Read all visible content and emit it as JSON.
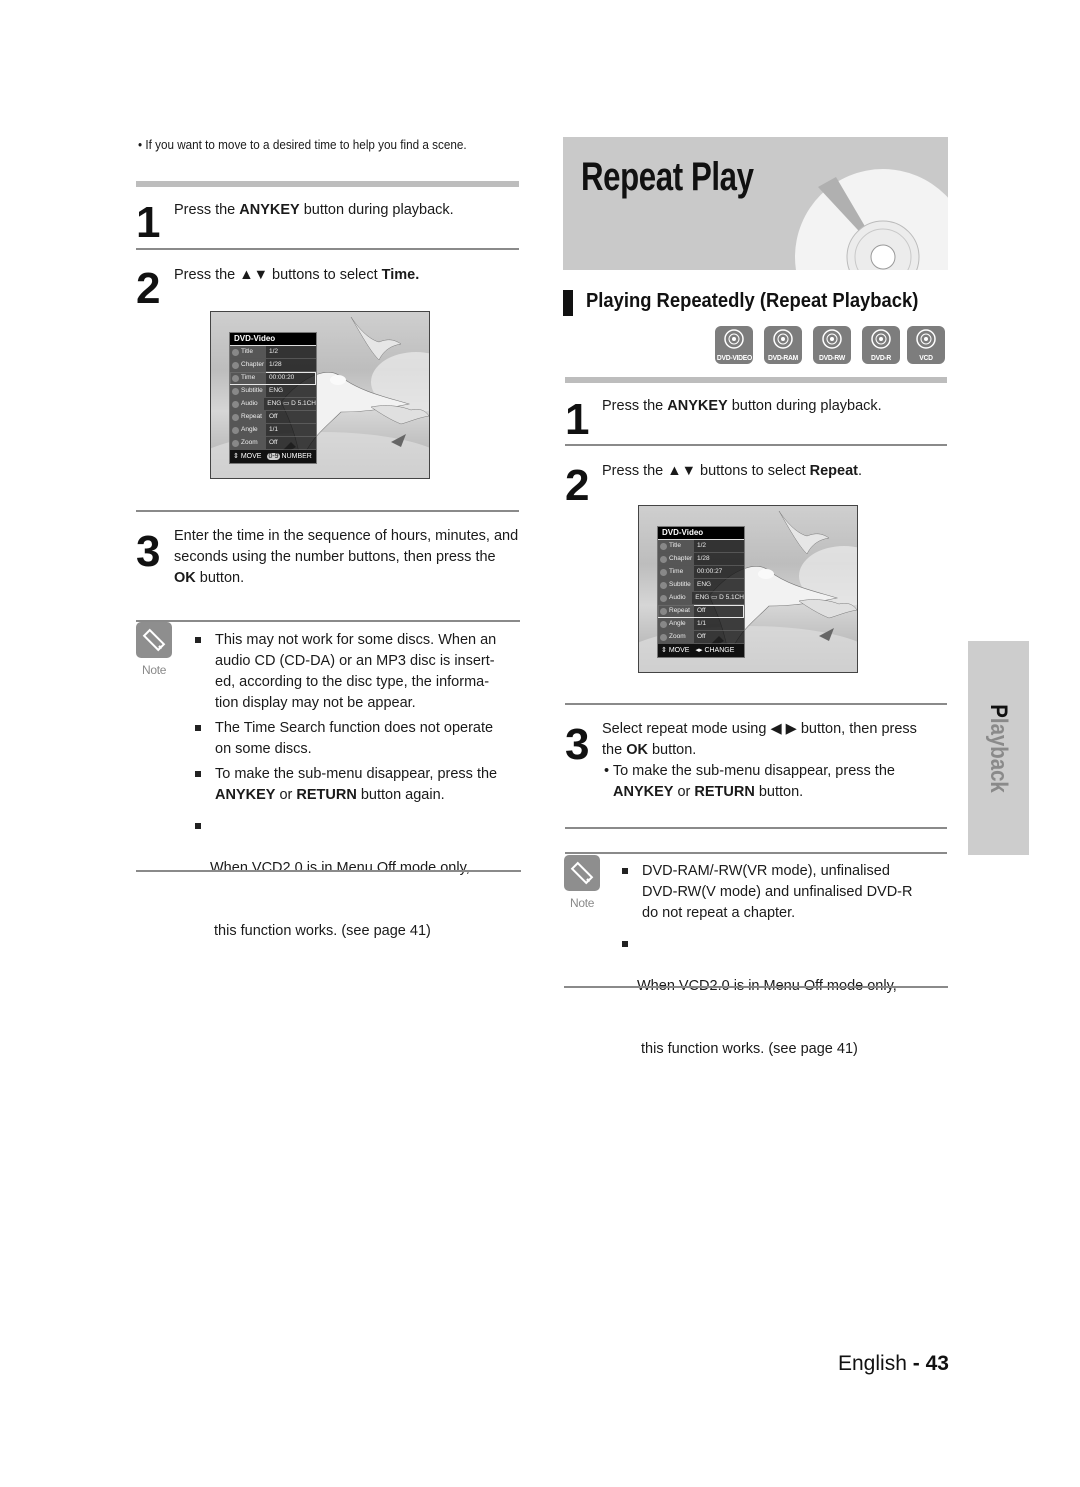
{
  "left": {
    "intro_bullet": "• If you want to move to a desired time to help you find a scene.",
    "steps": [
      {
        "num": "1",
        "pre": "Press the ",
        "bold": "ANYKEY",
        "post": " button during playback."
      },
      {
        "num": "2",
        "pre": "Press the ▲▼ buttons to select ",
        "bold": "Time.",
        "post": ""
      },
      {
        "num": "3",
        "line1": "Enter the time in the sequence of hours, minutes, and",
        "line2": "seconds using the number buttons, then press the",
        "line3_bold": "OK",
        "line3_rest": " button."
      }
    ],
    "osd": {
      "header": "DVD-Video",
      "rows": [
        {
          "label": "Title",
          "value": "1/2",
          "icon": "title-icon"
        },
        {
          "label": "Chapter",
          "value": "1/28",
          "icon": "chapter-icon"
        },
        {
          "label": "Time",
          "value": "00:00:20",
          "icon": "clock-icon",
          "selected": true
        },
        {
          "label": "Subtitle",
          "value": "ENG",
          "icon": "subtitle-icon"
        },
        {
          "label": "Audio",
          "value": "ENG ▭ D  5.1CH",
          "icon": "speaker-icon"
        },
        {
          "label": "Repeat",
          "value": "Off",
          "icon": "repeat-icon"
        },
        {
          "label": "Angle",
          "value": "1/1",
          "icon": "camera-icon"
        },
        {
          "label": "Zoom",
          "value": "Off",
          "icon": "zoom-icon"
        }
      ],
      "footer_move": "MOVE",
      "footer_action_glyph": "0-9",
      "footer_action": "NUMBER"
    },
    "note": {
      "label": "Note",
      "items": [
        {
          "lines": [
            "This may not work for some discs. When an",
            "audio CD (CD-DA) or an MP3 disc is insert-",
            "ed, according to the disc type, the informa-",
            "tion display may not be appear."
          ]
        },
        {
          "lines": [
            "The Time Search function does not operate",
            "on some discs."
          ]
        },
        {
          "line1": "To make the sub-menu disappear, press the",
          "b1": "ANYKEY",
          "mid": " or ",
          "b2": "RETURN",
          "end": " button again."
        },
        {
          "lines": [
            "When VCD2.0 is in Menu Off mode only,",
            " this function works. (see page 41)"
          ]
        }
      ]
    }
  },
  "right": {
    "banner_title": "Repeat Play",
    "section_title": "Playing Repeatedly (Repeat Playback)",
    "disc_badges": [
      "DVD-VIDEO",
      "DVD-RAM",
      "DVD-RW",
      "DVD-R",
      "VCD"
    ],
    "steps": [
      {
        "num": "1",
        "pre": "Press the ",
        "bold": "ANYKEY",
        "post": " button during playback."
      },
      {
        "num": "2",
        "pre": "Press the ▲▼ buttons to select ",
        "bold": "Repeat",
        "post": "."
      },
      {
        "num": "3",
        "line1": "Select repeat mode using ◀ ▶ button, then press",
        "line2_pre": "the ",
        "line2_bold": "OK",
        "line2_post": " button.",
        "sub1": "• To make the sub-menu disappear, press the",
        "sub2_b1": "ANYKEY",
        "sub2_mid": " or ",
        "sub2_b2": "RETURN",
        "sub2_end": " button."
      }
    ],
    "osd": {
      "header": "DVD-Video",
      "rows": [
        {
          "label": "Title",
          "value": "1/2",
          "icon": "title-icon"
        },
        {
          "label": "Chapter",
          "value": "1/28",
          "icon": "chapter-icon"
        },
        {
          "label": "Time",
          "value": "00:00:27",
          "icon": "clock-icon"
        },
        {
          "label": "Subtitle",
          "value": "ENG",
          "icon": "subtitle-icon"
        },
        {
          "label": "Audio",
          "value": "ENG ▭ D  5.1CH",
          "icon": "speaker-icon"
        },
        {
          "label": "Repeat",
          "value": "Off",
          "icon": "repeat-icon",
          "selected": true
        },
        {
          "label": "Angle",
          "value": "1/1",
          "icon": "camera-icon"
        },
        {
          "label": "Zoom",
          "value": "Off",
          "icon": "zoom-icon"
        }
      ],
      "footer_move": "MOVE",
      "footer_action_glyph": "◂▸",
      "footer_action": "CHANGE"
    },
    "note": {
      "label": "Note",
      "items": [
        {
          "lines": [
            "DVD-RAM/-RW(VR mode), unfinalised",
            "DVD-RW(V mode) and unfinalised DVD-R",
            "do not repeat a chapter."
          ]
        },
        {
          "lines": [
            "When VCD2.0 is in Menu Off mode only,",
            " this function works. (see page 41)"
          ]
        }
      ]
    }
  },
  "side_tab": {
    "first": "P",
    "rest": "layback"
  },
  "footer": {
    "lang": "English",
    "sep": " - ",
    "page": "43"
  }
}
